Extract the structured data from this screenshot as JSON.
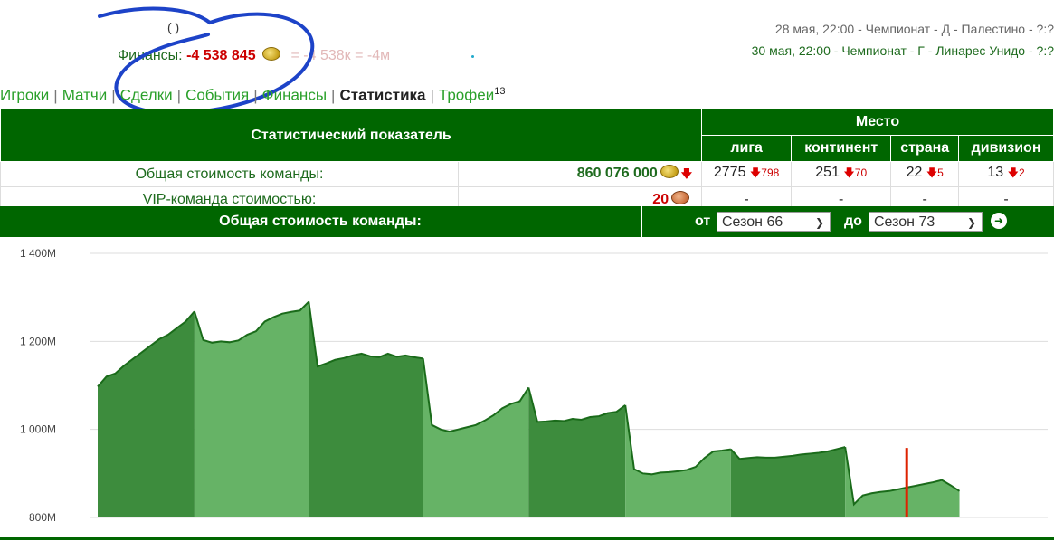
{
  "header": {
    "cut_line_text": "(                                   )",
    "finance_label": "Финансы:",
    "finance_value": "-4 538 845",
    "finance_short": "= -4 538к = -4м",
    "matches": [
      {
        "text": "28 мая, 22:00 - Чемпионат - Д - Палестино - ?:?"
      },
      {
        "text": "30 мая, 22:00 - Чемпионат - Г - Линарес Унидо - ?:?"
      }
    ]
  },
  "tabs": [
    {
      "label": "Игроки",
      "active": false
    },
    {
      "label": "Матчи",
      "active": false
    },
    {
      "label": "Сделки",
      "active": false
    },
    {
      "label": "События",
      "active": false
    },
    {
      "label": "Финансы",
      "active": false
    },
    {
      "label": "Статистика",
      "active": true
    },
    {
      "label": "Трофеи",
      "active": false,
      "badge": "13"
    }
  ],
  "stats_table": {
    "col_indicator": "Статистический показатель",
    "col_place": "Место",
    "col_league": "лига",
    "col_continent": "континент",
    "col_country": "страна",
    "col_division": "дивизион",
    "rows": [
      {
        "label": "Общая стоимость команды:",
        "value": "860 076 000",
        "league": "2775",
        "league_delta": "798",
        "continent": "251",
        "continent_delta": "70",
        "country": "22",
        "country_delta": "5",
        "division": "13",
        "division_delta": "2"
      },
      {
        "label": "VIP-команда стоимостью:",
        "value": "20",
        "league": "-",
        "continent": "-",
        "country": "-",
        "division": "-"
      }
    ]
  },
  "chart_header": {
    "title": "Общая стоимость команды:",
    "from_label": "от",
    "from_value": "Сезон 66",
    "to_label": "до",
    "to_value": "Сезон 73"
  },
  "colors": {
    "dark_green": "#006600",
    "fill_dark": "#3d8c3d",
    "fill_light": "#66b366",
    "line": "#1a6b1a",
    "marker": "#dd2200"
  },
  "chart_data": {
    "type": "area",
    "ylim": [
      800,
      1400
    ],
    "yticks": [
      {
        "value": 1400,
        "label": "1 400M"
      },
      {
        "value": 1200,
        "label": "1 200M"
      },
      {
        "value": 1000,
        "label": "1 000M"
      },
      {
        "value": 800,
        "label": "800M"
      }
    ],
    "x_range": [
      0,
      107
    ],
    "marker_x": 92,
    "series": [
      {
        "shade": "dark",
        "points": [
          [
            0,
            1097
          ],
          [
            1,
            1120
          ],
          [
            2,
            1127
          ],
          [
            3,
            1145
          ],
          [
            4,
            1160
          ],
          [
            5,
            1175
          ],
          [
            6,
            1190
          ],
          [
            7,
            1205
          ],
          [
            8,
            1215
          ],
          [
            9,
            1230
          ],
          [
            10,
            1245
          ],
          [
            11,
            1268
          ]
        ]
      },
      {
        "shade": "light",
        "points": [
          [
            11,
            1268
          ],
          [
            12,
            1203
          ],
          [
            13,
            1197
          ],
          [
            14,
            1200
          ],
          [
            15,
            1198
          ],
          [
            16,
            1202
          ],
          [
            17,
            1215
          ],
          [
            18,
            1223
          ],
          [
            19,
            1245
          ],
          [
            20,
            1255
          ],
          [
            21,
            1263
          ],
          [
            22,
            1267
          ],
          [
            23,
            1270
          ],
          [
            24,
            1290
          ]
        ]
      },
      {
        "shade": "dark",
        "points": [
          [
            24,
            1290
          ],
          [
            25,
            1143
          ],
          [
            26,
            1150
          ],
          [
            27,
            1158
          ],
          [
            28,
            1162
          ],
          [
            29,
            1168
          ],
          [
            30,
            1172
          ],
          [
            31,
            1166
          ],
          [
            32,
            1164
          ],
          [
            33,
            1172
          ],
          [
            34,
            1165
          ],
          [
            35,
            1168
          ],
          [
            36,
            1164
          ],
          [
            37,
            1161
          ]
        ]
      },
      {
        "shade": "light",
        "points": [
          [
            37,
            1161
          ],
          [
            38,
            1010
          ],
          [
            39,
            1000
          ],
          [
            40,
            995
          ],
          [
            41,
            1000
          ],
          [
            42,
            1005
          ],
          [
            43,
            1010
          ],
          [
            44,
            1020
          ],
          [
            45,
            1032
          ],
          [
            46,
            1048
          ],
          [
            47,
            1058
          ],
          [
            48,
            1064
          ],
          [
            49,
            1095
          ]
        ]
      },
      {
        "shade": "dark",
        "points": [
          [
            49,
            1095
          ],
          [
            50,
            1017
          ],
          [
            51,
            1018
          ],
          [
            52,
            1020
          ],
          [
            53,
            1019
          ],
          [
            54,
            1024
          ],
          [
            55,
            1022
          ],
          [
            56,
            1028
          ],
          [
            57,
            1030
          ],
          [
            58,
            1037
          ],
          [
            59,
            1040
          ],
          [
            60,
            1055
          ]
        ]
      },
      {
        "shade": "light",
        "points": [
          [
            60,
            1055
          ],
          [
            61,
            910
          ],
          [
            62,
            900
          ],
          [
            63,
            898
          ],
          [
            64,
            902
          ],
          [
            65,
            903
          ],
          [
            66,
            905
          ],
          [
            67,
            908
          ],
          [
            68,
            915
          ],
          [
            69,
            935
          ],
          [
            70,
            950
          ],
          [
            71,
            952
          ],
          [
            72,
            955
          ]
        ]
      },
      {
        "shade": "dark",
        "points": [
          [
            72,
            955
          ],
          [
            73,
            933
          ],
          [
            74,
            935
          ],
          [
            75,
            937
          ],
          [
            76,
            936
          ],
          [
            77,
            936
          ],
          [
            78,
            938
          ],
          [
            79,
            940
          ],
          [
            80,
            943
          ],
          [
            81,
            945
          ],
          [
            82,
            947
          ],
          [
            83,
            950
          ],
          [
            84,
            955
          ],
          [
            85,
            960
          ]
        ]
      },
      {
        "shade": "light",
        "points": [
          [
            85,
            960
          ],
          [
            86,
            830
          ],
          [
            87,
            850
          ],
          [
            88,
            855
          ],
          [
            89,
            858
          ],
          [
            90,
            860
          ],
          [
            91,
            864
          ],
          [
            92,
            868
          ],
          [
            93,
            872
          ],
          [
            94,
            876
          ],
          [
            95,
            880
          ],
          [
            96,
            885
          ],
          [
            97,
            873
          ],
          [
            98,
            860
          ]
        ]
      }
    ]
  }
}
